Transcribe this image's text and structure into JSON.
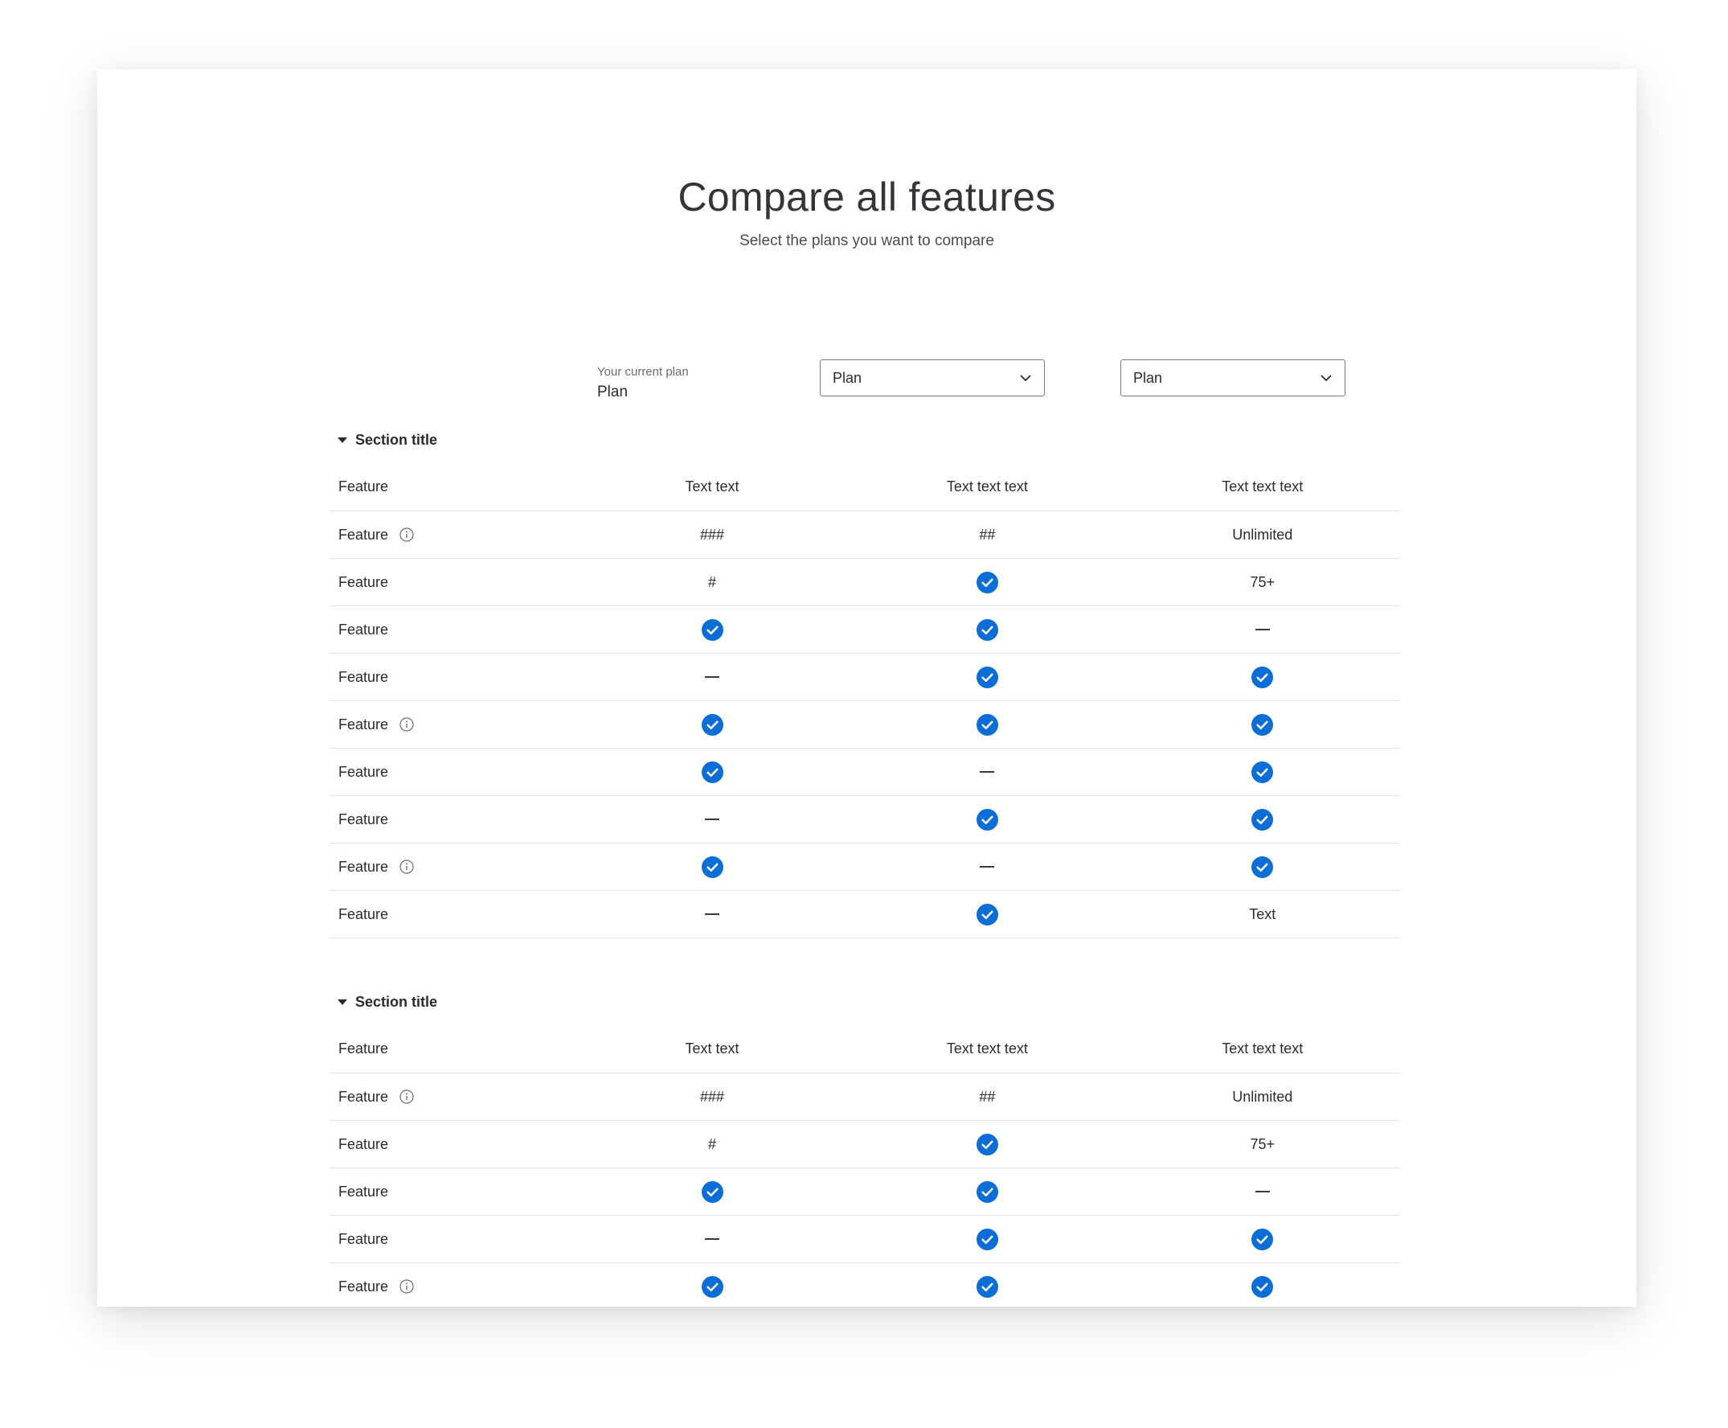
{
  "page": {
    "title": "Compare all features",
    "subtitle": "Select the plans you want to compare"
  },
  "current_plan": {
    "label": "Your current plan",
    "value": "Plan"
  },
  "plan_selects": [
    {
      "value": "Plan"
    },
    {
      "value": "Plan"
    }
  ],
  "accent_color": "#0b6dd6",
  "icons": {
    "check": "check-circle-icon",
    "info": "info-icon",
    "dash": "dash-icon",
    "caret": "caret-down-icon",
    "chevron": "chevron-down-icon"
  },
  "sections": [
    {
      "title": "Section title",
      "header": [
        "Feature",
        "Text text",
        "Text text text",
        "Text text text"
      ],
      "rows": [
        {
          "feature": "Feature",
          "info": true,
          "cells": [
            "###",
            "##",
            "Unlimited"
          ]
        },
        {
          "feature": "Feature",
          "info": false,
          "cells": [
            "#",
            "check",
            "75+"
          ]
        },
        {
          "feature": "Feature",
          "info": false,
          "cells": [
            "check",
            "check",
            "dash"
          ]
        },
        {
          "feature": "Feature",
          "info": false,
          "cells": [
            "dash",
            "check",
            "check"
          ]
        },
        {
          "feature": "Feature",
          "info": true,
          "cells": [
            "check",
            "check",
            "check"
          ]
        },
        {
          "feature": "Feature",
          "info": false,
          "cells": [
            "check",
            "dash",
            "check"
          ]
        },
        {
          "feature": "Feature",
          "info": false,
          "cells": [
            "dash",
            "check",
            "check"
          ]
        },
        {
          "feature": "Feature",
          "info": true,
          "cells": [
            "check",
            "dash",
            "check"
          ]
        },
        {
          "feature": "Feature",
          "info": false,
          "cells": [
            "dash",
            "check",
            "Text"
          ]
        }
      ]
    },
    {
      "title": "Section title",
      "header": [
        "Feature",
        "Text text",
        "Text text text",
        "Text text text"
      ],
      "rows": [
        {
          "feature": "Feature",
          "info": true,
          "cells": [
            "###",
            "##",
            "Unlimited"
          ]
        },
        {
          "feature": "Feature",
          "info": false,
          "cells": [
            "#",
            "check",
            "75+"
          ]
        },
        {
          "feature": "Feature",
          "info": false,
          "cells": [
            "check",
            "check",
            "dash"
          ]
        },
        {
          "feature": "Feature",
          "info": false,
          "cells": [
            "dash",
            "check",
            "check"
          ]
        },
        {
          "feature": "Feature",
          "info": true,
          "cells": [
            "check",
            "check",
            "check"
          ]
        }
      ]
    }
  ]
}
